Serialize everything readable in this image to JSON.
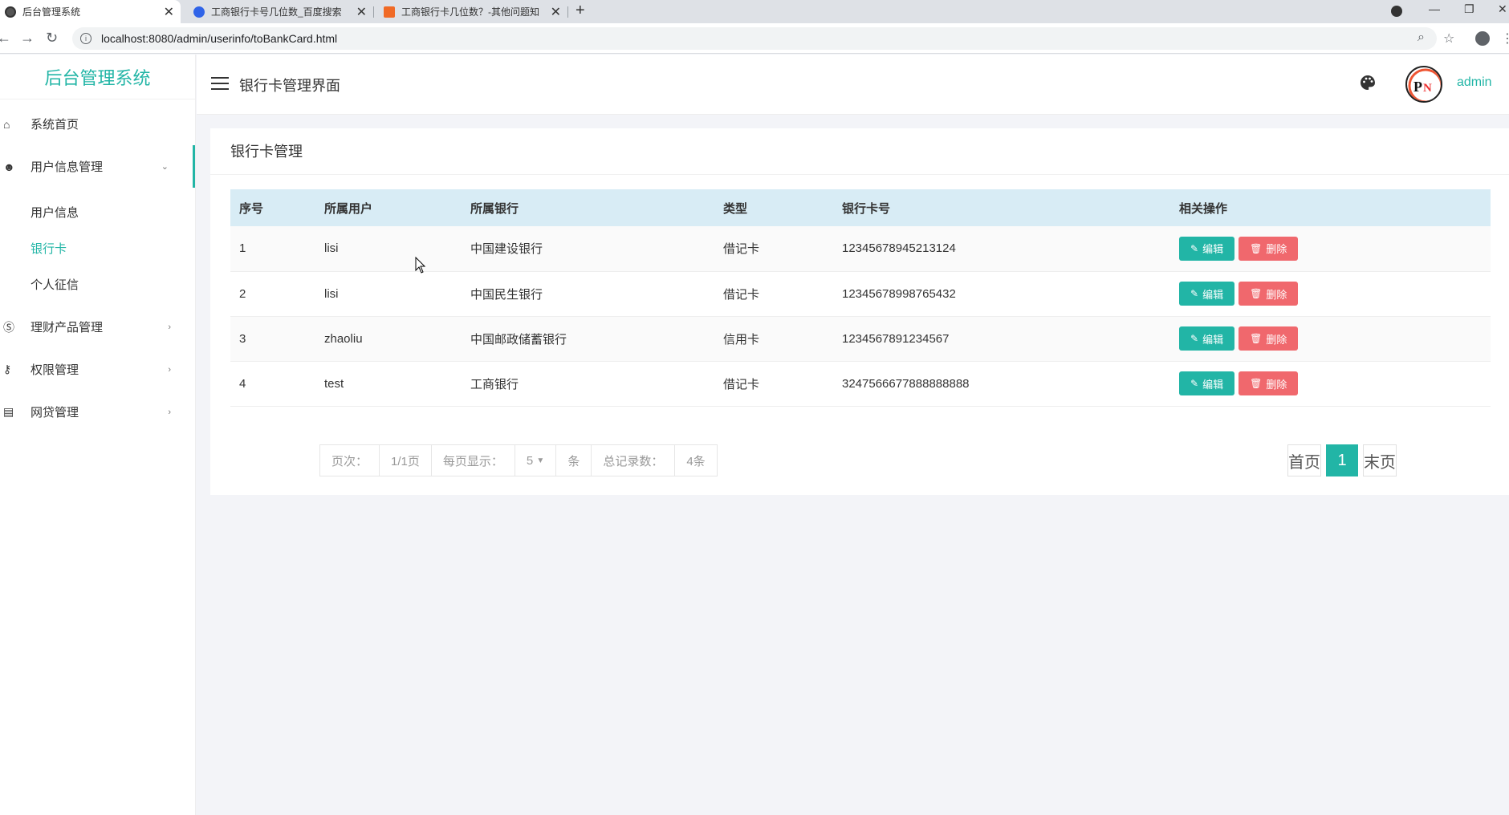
{
  "browser": {
    "tabs": [
      {
        "title": "后台管理系统",
        "active": true
      },
      {
        "title": "工商银行卡号几位数_百度搜索",
        "active": false
      },
      {
        "title": "工商银行卡几位数？-其他问题知",
        "active": false
      }
    ],
    "url": "localhost:8080/admin/userinfo/toBankCard.html"
  },
  "sidebar": {
    "brand": "后台管理系统",
    "items": [
      {
        "label": "系统首页",
        "icon": "home-icon"
      },
      {
        "label": "用户信息管理",
        "icon": "user-gear-icon",
        "expanded": true,
        "children": [
          {
            "label": "用户信息",
            "active": false
          },
          {
            "label": "银行卡",
            "active": true
          },
          {
            "label": "个人征信",
            "active": false
          }
        ]
      },
      {
        "label": "理财产品管理",
        "icon": "dollar-circle-icon"
      },
      {
        "label": "权限管理",
        "icon": "key-icon"
      },
      {
        "label": "网贷管理",
        "icon": "comment-icon"
      }
    ]
  },
  "header": {
    "title": "银行卡管理界面",
    "username": "admin"
  },
  "card": {
    "title": "银行卡管理",
    "columns": [
      "序号",
      "所属用户",
      "所属银行",
      "类型",
      "银行卡号",
      "相关操作"
    ],
    "rows": [
      {
        "id": "1",
        "user": "lisi",
        "bank": "中国建设银行",
        "type": "借记卡",
        "card": "12345678945213124"
      },
      {
        "id": "2",
        "user": "lisi",
        "bank": "中国民生银行",
        "type": "借记卡",
        "card": "12345678998765432"
      },
      {
        "id": "3",
        "user": "zhaoliu",
        "bank": "中国邮政储蓄银行",
        "type": "信用卡",
        "card": "1234567891234567"
      },
      {
        "id": "4",
        "user": "test",
        "bank": "工商银行",
        "type": "借记卡",
        "card": "3247566677888888888"
      }
    ],
    "edit_label": "编辑",
    "delete_label": "删除"
  },
  "pagination": {
    "page_label": "页次：",
    "page_value": "1/1页",
    "per_page_label": "每页显示：",
    "per_page_value": "5",
    "unit": "条",
    "total_label": "总记录数：",
    "total_value": "4条",
    "first": "首页",
    "current": "1",
    "last": "末页"
  },
  "colors": {
    "accent": "#22b5a6",
    "danger": "#f0686d"
  }
}
